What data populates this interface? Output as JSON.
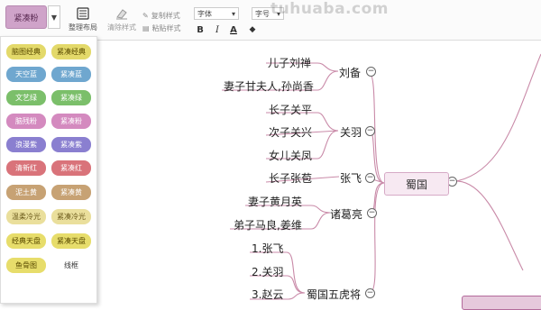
{
  "toolbar": {
    "theme_label": "紧凑粉",
    "dropdown_arrow": "▼",
    "layout_label": "整理布局",
    "clear_style_label": "清除样式",
    "copy_style_label": "复制样式",
    "paste_style_label": "粘贴样式",
    "font_label": "字体",
    "font_size_label": "字号",
    "bold_label": "B",
    "italic_label": "I",
    "font_color_label": "A",
    "fill_label": "◆"
  },
  "watermark": "tuhuaba.com",
  "theme_panel": {
    "items": [
      {
        "label": "脑图经典",
        "bg": "#e3d96a",
        "fg": "#5a4b00"
      },
      {
        "label": "紧凑经典",
        "bg": "#e3d96a",
        "fg": "#5a4b00"
      },
      {
        "label": "天空蓝",
        "bg": "#6fa7cf",
        "fg": "#ffffff"
      },
      {
        "label": "紧凑蓝",
        "bg": "#6fa7cf",
        "fg": "#ffffff"
      },
      {
        "label": "文艺绿",
        "bg": "#7bbf6a",
        "fg": "#ffffff"
      },
      {
        "label": "紧凑绿",
        "bg": "#7bbf6a",
        "fg": "#ffffff"
      },
      {
        "label": "脑残粉",
        "bg": "#d48abf",
        "fg": "#ffffff"
      },
      {
        "label": "紧凑粉",
        "bg": "#d48abf",
        "fg": "#ffffff"
      },
      {
        "label": "浪漫紫",
        "bg": "#8a7fd0",
        "fg": "#ffffff"
      },
      {
        "label": "紧凑紫",
        "bg": "#8a7fd0",
        "fg": "#ffffff"
      },
      {
        "label": "清新红",
        "bg": "#d9737a",
        "fg": "#ffffff"
      },
      {
        "label": "紧凑红",
        "bg": "#d9737a",
        "fg": "#ffffff"
      },
      {
        "label": "泥土黄",
        "bg": "#c7a274",
        "fg": "#ffffff"
      },
      {
        "label": "紧凑黄",
        "bg": "#c7a274",
        "fg": "#ffffff"
      },
      {
        "label": "温柔冷光",
        "bg": "#eadf9c",
        "fg": "#6b5a1a"
      },
      {
        "label": "紧凑冷光",
        "bg": "#eadf9c",
        "fg": "#6b5a1a"
      },
      {
        "label": "经典天盘",
        "bg": "#e7dd6b",
        "fg": "#5a4b00"
      },
      {
        "label": "紧凑天盘",
        "bg": "#e7dd6b",
        "fg": "#5a4b00"
      },
      {
        "label": "鱼骨图",
        "bg": "#e7dd6b",
        "fg": "#5a4b00"
      },
      {
        "label": "线框",
        "bg": "#ffffff",
        "fg": "#333333"
      }
    ]
  },
  "mindmap": {
    "root": "蜀国",
    "branches": {
      "liubei": "刘备",
      "guanyu": "关羽",
      "zhangfei": "张飞",
      "zhuge": "诸葛亮",
      "wuhu": "蜀国五虎将"
    },
    "leaves": {
      "liubei_son": "儿子刘禅",
      "liubei_wife": "妻子甘夫人,孙尚香",
      "guanyu_son1": "长子关平",
      "guanyu_son2": "次子关兴",
      "guanyu_daughter": "女儿关凤",
      "zhangfei_son": "长子张苞",
      "zhuge_wife": "妻子黄月英",
      "zhuge_student": "弟子马良,姜维",
      "wuhu_1": "1.张飞",
      "wuhu_2": "2.关羽",
      "wuhu_3": "3.赵云"
    },
    "collapse_symbol": "−"
  },
  "colors": {
    "branch_line": "#c98aa8",
    "accent": "#cfa3c9"
  }
}
